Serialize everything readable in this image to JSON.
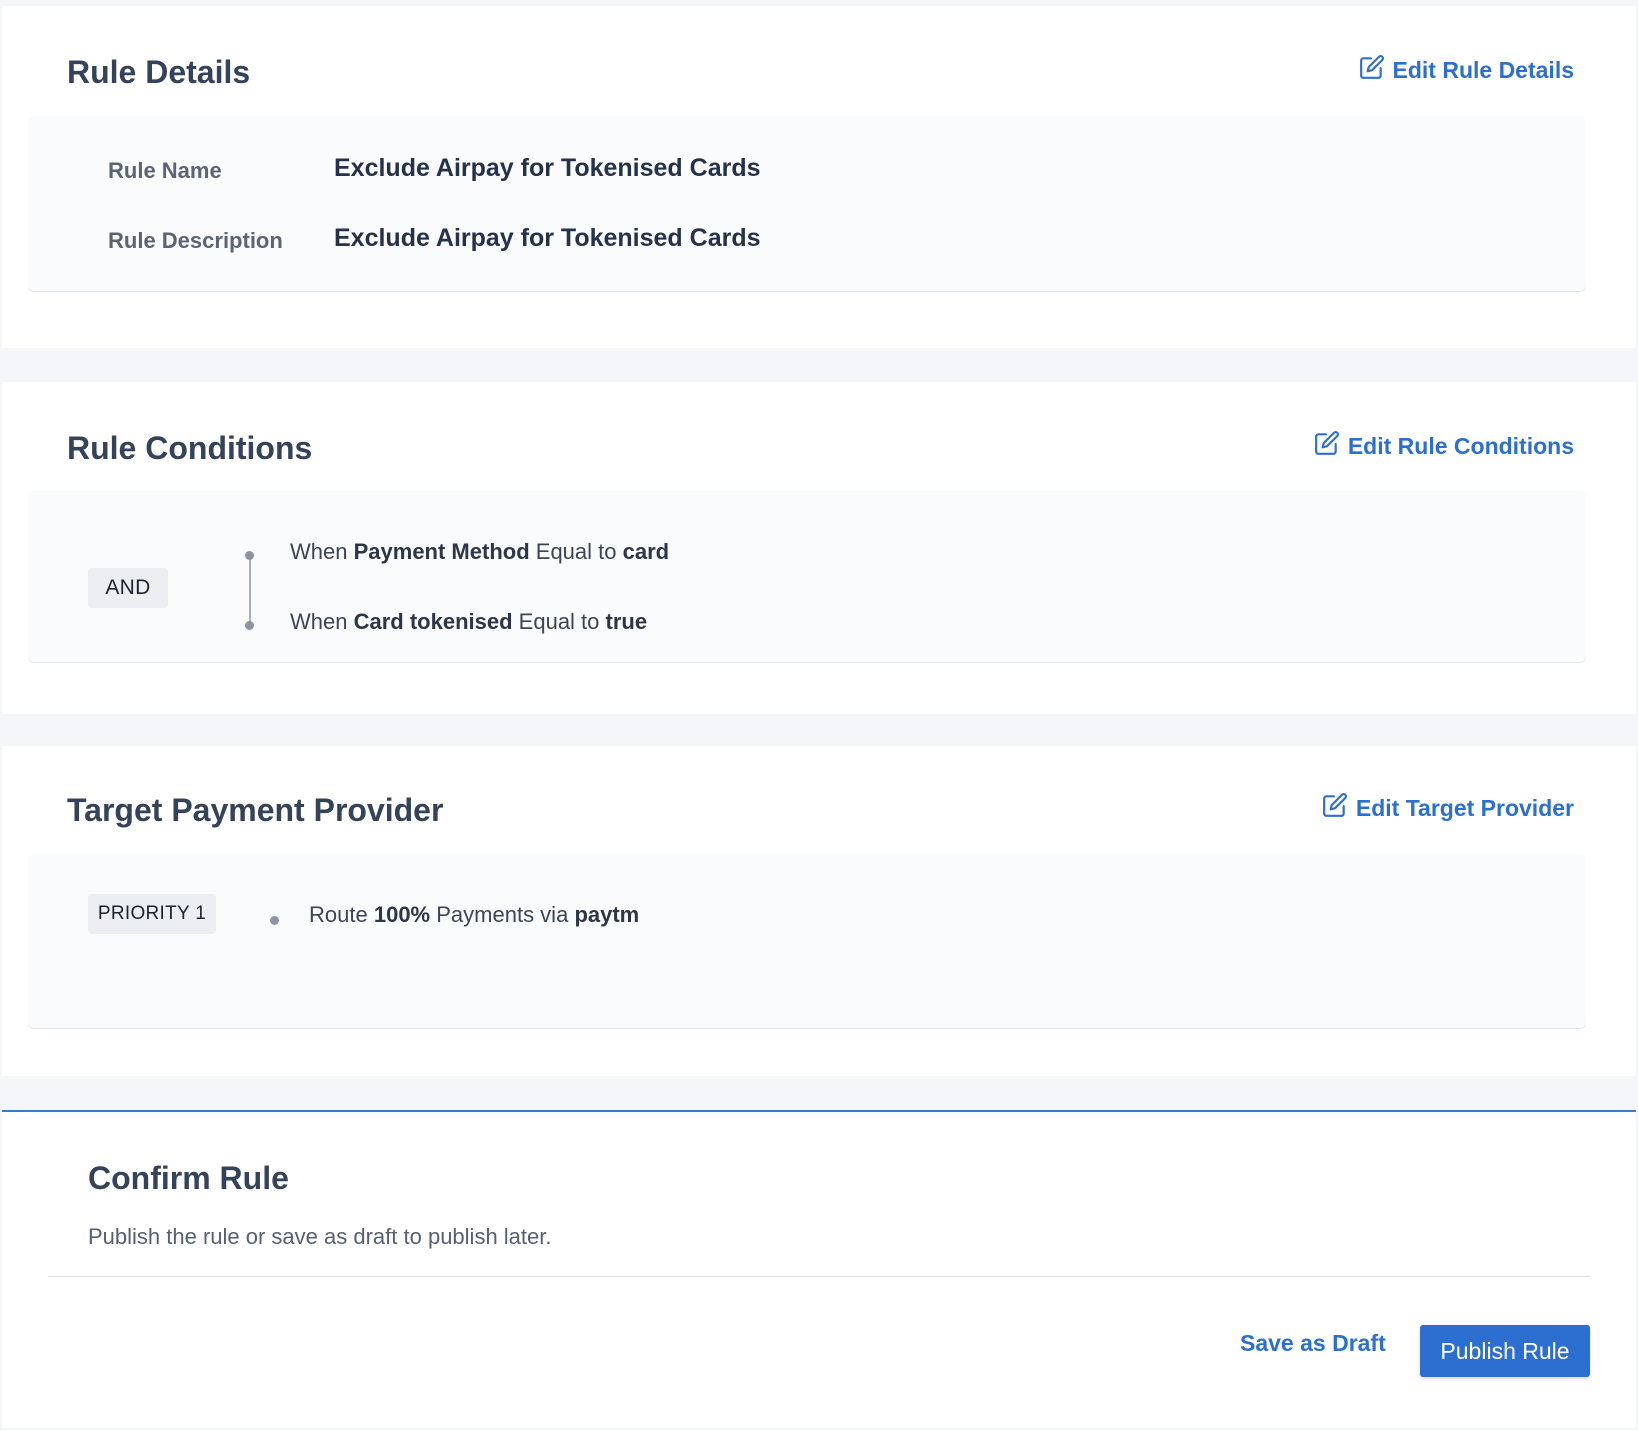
{
  "rule_details": {
    "title": "Rule Details",
    "edit_label": "Edit Rule Details",
    "name_label": "Rule Name",
    "name_value": "Exclude Airpay for Tokenised Cards",
    "description_label": "Rule Description",
    "description_value": "Exclude Airpay for Tokenised Cards"
  },
  "rule_conditions": {
    "title": "Rule Conditions",
    "edit_label": "Edit Rule Conditions",
    "operator": "AND",
    "conditions": [
      {
        "prefix": "When",
        "field": "Payment Method",
        "comparator": "Equal to",
        "value": "card"
      },
      {
        "prefix": "When",
        "field": "Card tokenised",
        "comparator": "Equal to",
        "value": "true"
      }
    ]
  },
  "target_provider": {
    "title": "Target Payment Provider",
    "edit_label": "Edit Target Provider",
    "priority_label": "PRIORITY 1",
    "route": {
      "prefix": "Route",
      "percent": "100%",
      "middle": "Payments via",
      "provider": "paytm"
    }
  },
  "confirm": {
    "title": "Confirm Rule",
    "subtitle": "Publish the rule or save as draft to publish later.",
    "draft_label": "Save as Draft",
    "publish_label": "Publish Rule"
  },
  "colors": {
    "accent": "#2d6fd1",
    "heading": "#34425a",
    "background": "#f4f6fa"
  }
}
